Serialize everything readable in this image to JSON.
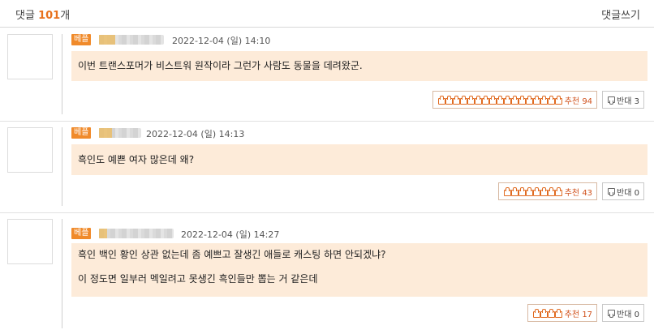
{
  "header": {
    "label": "댓글",
    "count": "101",
    "suffix": "개",
    "write_label": "댓글쓰기"
  },
  "comments": [
    {
      "badge": "베플",
      "date": "2022-12-04 (일) 14:10",
      "lines": [
        "이번 트랜스포머가 비스트워 원작이라 그런가 사람도 동물을 데려왔군."
      ],
      "recommend_label": "추천 94",
      "recommend_icons": 17,
      "oppose_label": "반대 3"
    },
    {
      "badge": "베플",
      "date": "2022-12-04 (일) 14:13",
      "lines": [
        "흑인도 예쁜 여자 많은데 왜?"
      ],
      "recommend_label": "추천 43",
      "recommend_icons": 8,
      "oppose_label": "반대 0"
    },
    {
      "badge": "베플",
      "date": "2022-12-04 (일) 14:27",
      "lines": [
        "흑인 백인 황인 상관 없는데 좀 예쁘고 잘생긴 애들로 캐스팅 하면 안되겠냐?",
        "이 정도면 일부러 멕일려고 못생긴 흑인들만 뽑는 거 같은데"
      ],
      "recommend_label": "추천 17",
      "recommend_icons": 4,
      "oppose_label": "반대 0"
    }
  ]
}
